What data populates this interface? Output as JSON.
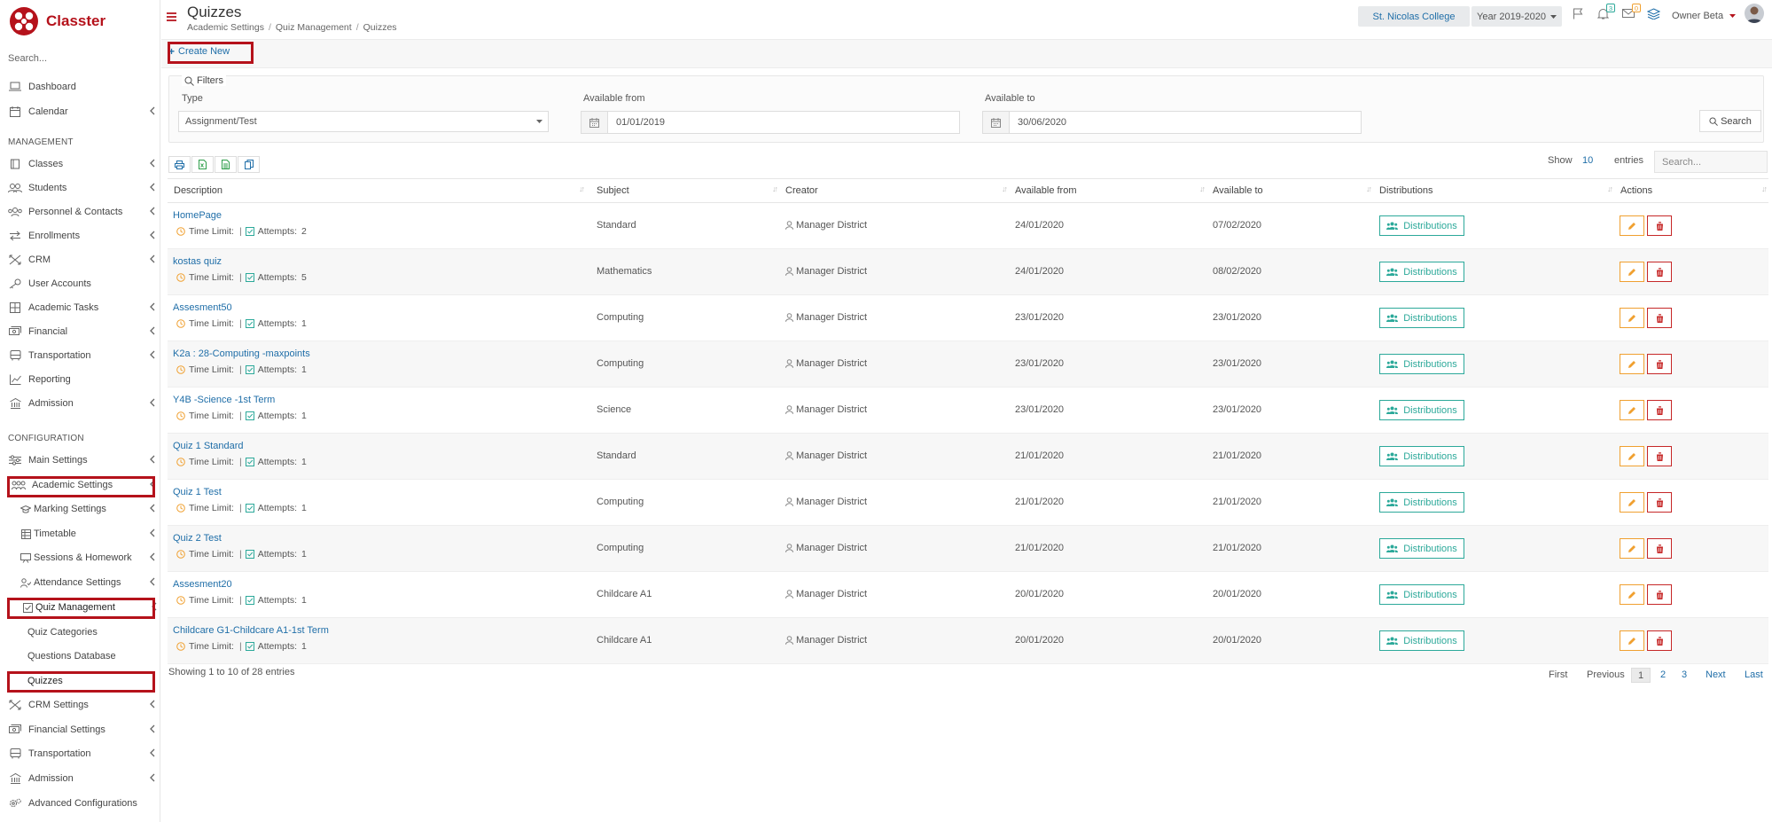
{
  "brand": {
    "name": "Classter",
    "color": "#b5121b"
  },
  "sidebar": {
    "search_placeholder": "Search...",
    "sections": {
      "management": "MANAGEMENT",
      "configuration": "CONFIGURATION"
    },
    "items": [
      {
        "label": "Dashboard",
        "icon": "laptop-icon"
      },
      {
        "label": "Calendar",
        "icon": "calendar-icon",
        "has_children": true
      },
      {
        "label": "Classes",
        "icon": "book-icon",
        "has_children": true
      },
      {
        "label": "Students",
        "icon": "students-icon",
        "has_children": true
      },
      {
        "label": "Personnel & Contacts",
        "icon": "contacts-icon",
        "has_children": true
      },
      {
        "label": "Enrollments",
        "icon": "arrows-icon",
        "has_children": true
      },
      {
        "label": "CRM",
        "icon": "crm-icon",
        "has_children": true
      },
      {
        "label": "User Accounts",
        "icon": "key-icon"
      },
      {
        "label": "Academic Tasks",
        "icon": "grid-icon",
        "has_children": true
      },
      {
        "label": "Financial",
        "icon": "money-icon",
        "has_children": true
      },
      {
        "label": "Transportation",
        "icon": "bus-icon",
        "has_children": true
      },
      {
        "label": "Reporting",
        "icon": "chart-icon"
      },
      {
        "label": "Admission",
        "icon": "building-icon",
        "has_children": true
      },
      {
        "label": "Main Settings",
        "icon": "sliders-icon",
        "has_children": true
      },
      {
        "label": "Academic Settings",
        "icon": "people-icon",
        "has_children": true
      },
      {
        "label": "Marking Settings",
        "icon": "graduation-cap-icon",
        "has_children": true
      },
      {
        "label": "Timetable",
        "icon": "timetable-icon",
        "has_children": true
      },
      {
        "label": "Sessions & Homework",
        "icon": "chalkboard-icon",
        "has_children": true
      },
      {
        "label": "Attendance Settings",
        "icon": "user-check-icon",
        "has_children": true
      },
      {
        "label": "Quiz Management",
        "icon": "checkbox-icon",
        "has_children": true
      },
      {
        "label": "Quiz Categories"
      },
      {
        "label": "Questions Database"
      },
      {
        "label": "Quizzes"
      },
      {
        "label": "CRM Settings",
        "icon": "crm-icon",
        "has_children": true
      },
      {
        "label": "Financial Settings",
        "icon": "money-icon",
        "has_children": true
      },
      {
        "label": "Transportation",
        "icon": "bus-icon",
        "has_children": true
      },
      {
        "label": "Admission",
        "icon": "building-icon",
        "has_children": true
      },
      {
        "label": "Advanced Configurations",
        "icon": "cogs-icon"
      }
    ]
  },
  "header": {
    "title": "Quizzes",
    "breadcrumb": [
      "Academic Settings",
      "Quiz Management",
      "Quizzes"
    ],
    "school": "St. Nicolas College",
    "year": "Year 2019-2020",
    "notifications_count": "3",
    "messages_count": "0",
    "user_name": "Owner Beta"
  },
  "toolbar": {
    "create_label": "Create New"
  },
  "filters": {
    "legend": "Filters",
    "type_label": "Type",
    "type_value": "Assignment/Test",
    "from_label": "Available from",
    "from_value": "01/01/2019",
    "to_label": "Available to",
    "to_value": "30/06/2020",
    "search_label": "Search"
  },
  "table": {
    "show_label": "Show",
    "page_size": "10",
    "entries_label": "entries",
    "search_placeholder": "Search...",
    "columns": [
      "Description",
      "Subject",
      "Creator",
      "Available from",
      "Available to",
      "Distributions",
      "Actions"
    ],
    "time_limit_label": "Time Limit:",
    "attempts_label": "Attempts:",
    "distributions_label": "Distributions",
    "rows": [
      {
        "description": "HomePage",
        "attempts": "2",
        "subject": "Standard",
        "creator": "Manager District",
        "from": "24/01/2020",
        "to": "07/02/2020"
      },
      {
        "description": "kostas quiz",
        "attempts": "5",
        "subject": "Mathematics",
        "creator": "Manager District",
        "from": "24/01/2020",
        "to": "08/02/2020"
      },
      {
        "description": "Assesment50",
        "attempts": "1",
        "subject": "Computing",
        "creator": "Manager District",
        "from": "23/01/2020",
        "to": "23/01/2020"
      },
      {
        "description": "K2a : 28-Computing -maxpoints",
        "attempts": "1",
        "subject": "Computing",
        "creator": "Manager District",
        "from": "23/01/2020",
        "to": "23/01/2020"
      },
      {
        "description": "Y4B -Science -1st Term",
        "attempts": "1",
        "subject": "Science",
        "creator": "Manager District",
        "from": "23/01/2020",
        "to": "23/01/2020"
      },
      {
        "description": "Quiz 1 Standard",
        "attempts": "1",
        "subject": "Standard",
        "creator": "Manager District",
        "from": "21/01/2020",
        "to": "21/01/2020"
      },
      {
        "description": "Quiz 1 Test",
        "attempts": "1",
        "subject": "Computing",
        "creator": "Manager District",
        "from": "21/01/2020",
        "to": "21/01/2020"
      },
      {
        "description": "Quiz 2 Test",
        "attempts": "1",
        "subject": "Computing",
        "creator": "Manager District",
        "from": "21/01/2020",
        "to": "21/01/2020"
      },
      {
        "description": "Assesment20",
        "attempts": "1",
        "subject": "Childcare A1",
        "creator": "Manager District",
        "from": "20/01/2020",
        "to": "20/01/2020"
      },
      {
        "description": "Childcare G1-Childcare A1-1st Term",
        "attempts": "1",
        "subject": "Childcare A1",
        "creator": "Manager District",
        "from": "20/01/2020",
        "to": "20/01/2020"
      }
    ]
  },
  "footer": {
    "showing_text": "Showing 1 to 10 of 28 entries",
    "pagination": {
      "first": "First",
      "previous": "Previous",
      "pages": [
        "1",
        "2",
        "3"
      ],
      "next": "Next",
      "last": "Last"
    }
  },
  "colors": {
    "accent_red": "#b5121b",
    "link_blue": "#1f6ea8",
    "teal": "#2ca99a",
    "edit_orange": "#f0a030",
    "delete_red": "#c62828"
  }
}
